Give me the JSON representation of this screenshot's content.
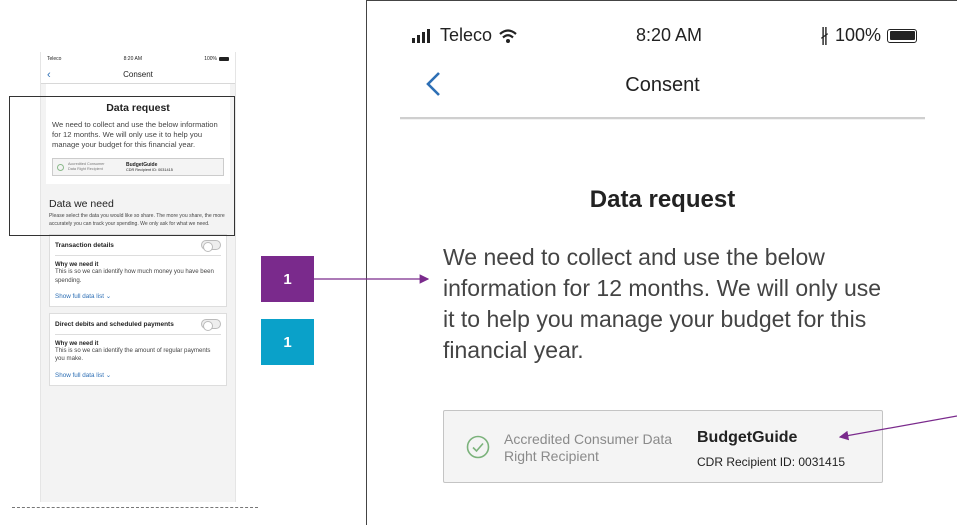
{
  "status_bar": {
    "carrier": "Teleco",
    "time": "8:20 AM",
    "battery": "100%"
  },
  "nav": {
    "back_icon": "chevron-left-icon",
    "title": "Consent"
  },
  "data_request": {
    "heading": "Data request",
    "body": "We need to collect and use the below information for 12 months. We will only use it to help you manage your budget for this financial year."
  },
  "accreditation": {
    "label": "Accredited Consumer Data Right Recipient",
    "brand": "BudgetGuide",
    "recipient_id": "CDR Recipient ID: 0031415"
  },
  "data_we_need": {
    "heading": "Data we need",
    "intro": "Please select the data you would like so share. The more you share, the more accurately you can track your spending. We only ask for what we need.",
    "items": [
      {
        "title": "Transaction details",
        "why_label": "Why we need it",
        "why_body": "This is so we can identify how much money you have been spending.",
        "show_label": "Show full data list"
      },
      {
        "title": "Direct debits and scheduled payments",
        "why_label": "Why we need it",
        "why_body": "This is so we can identify the amount of regular payments you make.",
        "show_label": "Show full data list"
      }
    ]
  },
  "markers": [
    {
      "label": "1",
      "color": "#7a2a8c"
    },
    {
      "label": "1",
      "color": "#0aa1c9"
    }
  ],
  "colors": {
    "link": "#2d6fb5",
    "arrow": "#7a2a8c",
    "background": "#f2f2f2"
  }
}
